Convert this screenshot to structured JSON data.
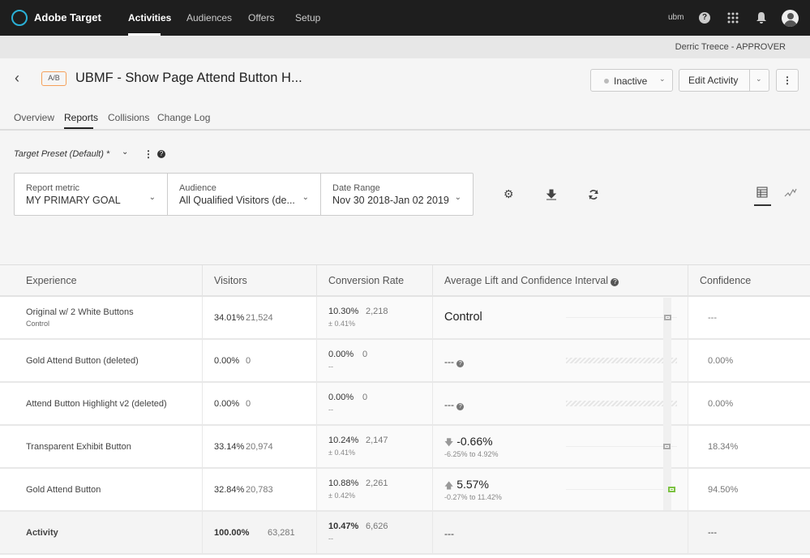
{
  "topbar": {
    "brand": "Adobe Target",
    "nav": [
      "Activities",
      "Audiences",
      "Offers",
      "Setup"
    ],
    "user": "ubm"
  },
  "subbar": {
    "user_role": "Derric Treece - APPROVER"
  },
  "activity": {
    "type_badge": "A/B",
    "title": "UBMF - Show Page Attend Button H...",
    "status": "Inactive",
    "edit_label": "Edit Activity"
  },
  "tabs": [
    "Overview",
    "Reports",
    "Collisions",
    "Change Log"
  ],
  "preset": {
    "label": "Target Preset (Default) *"
  },
  "filters": {
    "metric_label": "Report metric",
    "metric_value": "MY PRIMARY GOAL",
    "audience_label": "Audience",
    "audience_value": "All Qualified Visitors (de...",
    "date_label": "Date Range",
    "date_value": "Nov 30 2018-Jan 02 2019"
  },
  "table": {
    "headers": [
      "Experience",
      "Visitors",
      "Conversion Rate",
      "Average Lift and Confidence Interval",
      "Confidence"
    ],
    "rows": [
      {
        "name": "Original w/ 2 White Buttons",
        "sub": "Control",
        "visitors_pct": "34.01%",
        "visitors": "21,524",
        "conv_rate": "10.30%",
        "conversions": "2,218",
        "conv_ci": "± 0.41%",
        "lift": "Control",
        "lift_range": "",
        "confidence": "---",
        "marker": "control"
      },
      {
        "name": "Gold Attend Button (deleted)",
        "sub": "",
        "visitors_pct": "0.00%",
        "visitors": "0",
        "conv_rate": "0.00%",
        "conversions": "0",
        "conv_ci": "--",
        "lift": "---",
        "lift_range": "",
        "confidence": "0.00%",
        "marker": "none"
      },
      {
        "name": "Attend Button Highlight v2 (deleted)",
        "sub": "",
        "visitors_pct": "0.00%",
        "visitors": "0",
        "conv_rate": "0.00%",
        "conversions": "0",
        "conv_ci": "--",
        "lift": "---",
        "lift_range": "",
        "confidence": "0.00%",
        "marker": "none"
      },
      {
        "name": "Transparent Exhibit Button",
        "sub": "",
        "visitors_pct": "33.14%",
        "visitors": "20,974",
        "conv_rate": "10.24%",
        "conversions": "2,147",
        "conv_ci": "± 0.41%",
        "lift": "-0.66%",
        "lift_dir": "down",
        "lift_range": "-6.25%  to  4.92%",
        "confidence": "18.34%",
        "marker": "gray"
      },
      {
        "name": "Gold Attend Button",
        "sub": "",
        "visitors_pct": "32.84%",
        "visitors": "20,783",
        "conv_rate": "10.88%",
        "conversions": "2,261",
        "conv_ci": "± 0.42%",
        "lift": "5.57%",
        "lift_dir": "up",
        "lift_range": "-0.27%  to  11.42%",
        "confidence": "94.50%",
        "marker": "green"
      },
      {
        "name": "Activity",
        "sub": "",
        "visitors_pct": "100.00%",
        "visitors": "63,281",
        "conv_rate": "10.47%",
        "conversions": "6,626",
        "conv_ci": "--",
        "lift": "---",
        "lift_range": "",
        "confidence": "---",
        "marker": "total"
      }
    ]
  },
  "colors": {
    "accent": "#2ab0d6",
    "badge": "#f5a05a",
    "positive": "#7cc242"
  }
}
